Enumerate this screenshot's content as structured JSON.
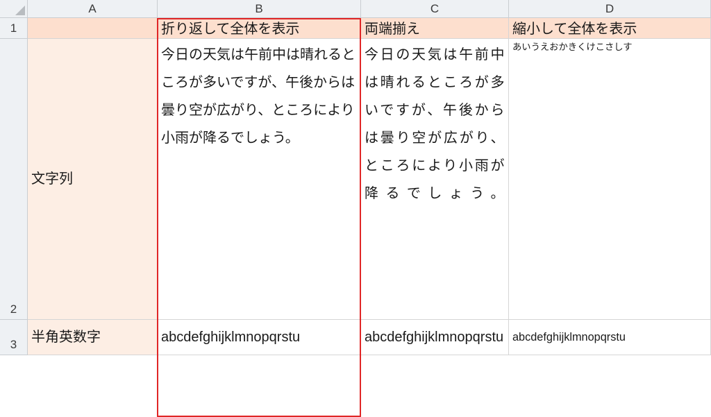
{
  "columns": {
    "A": "A",
    "B": "B",
    "C": "C",
    "D": "D"
  },
  "rows": {
    "r1": "1",
    "r2": "2",
    "r3": "3"
  },
  "headers": {
    "b1": "折り返して全体を表示",
    "c1": "両端揃え",
    "d1": "縮小して全体を表示"
  },
  "labels": {
    "a2": "文字列",
    "a3": "半角英数字"
  },
  "body": {
    "b2": "今日の天気は午前中は晴れるところが多いですが、午後からは曇り空が広がり、ところにより小雨が降るでしょう。",
    "c2": "今日の天気は午前中は晴れるところが多いですが、午後からは曇り空が広がり、ところにより小雨が降るでしょう。",
    "d2": "あいうえおかきくけこさしす",
    "b3": "abcdefghijklmnopqrstu",
    "c3": "abcdefghijklmnopqrstu",
    "d3": "abcdefghijklmnopqrstu"
  }
}
